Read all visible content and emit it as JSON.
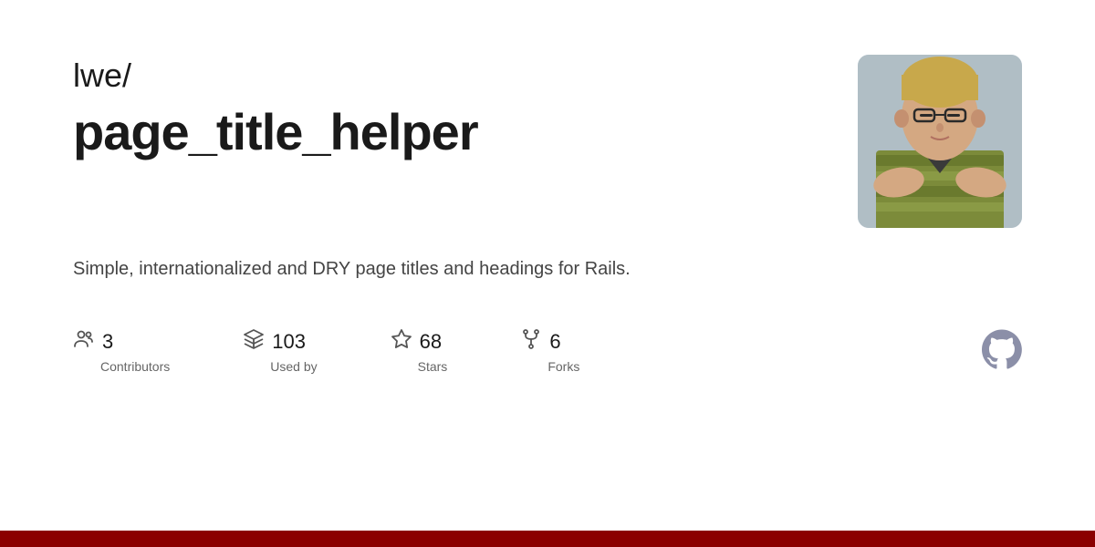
{
  "repo": {
    "namespace": "lwe/",
    "name": "page_title_helper",
    "description": "Simple, internationalized and DRY page titles and headings for Rails."
  },
  "stats": [
    {
      "id": "contributors",
      "count": "3",
      "label": "Contributors",
      "icon": "people"
    },
    {
      "id": "used-by",
      "count": "103",
      "label": "Used by",
      "icon": "package"
    },
    {
      "id": "stars",
      "count": "68",
      "label": "Stars",
      "icon": "star"
    },
    {
      "id": "forks",
      "count": "6",
      "label": "Forks",
      "icon": "fork"
    }
  ],
  "bottom_bar": {
    "color": "#8b0000"
  }
}
